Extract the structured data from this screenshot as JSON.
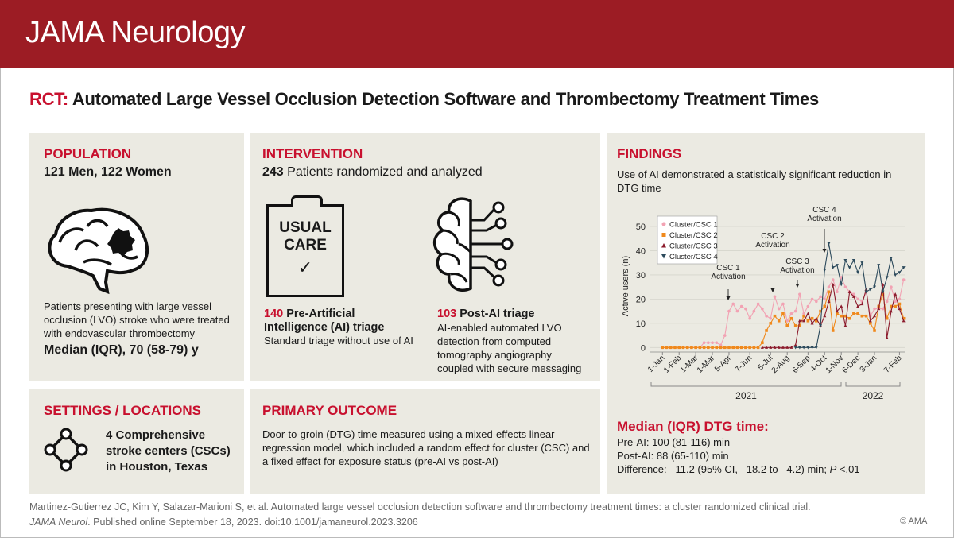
{
  "header": {
    "journal": "JAMA Neurology"
  },
  "title": {
    "prefix": "RCT:",
    "main": "Automated Large Vessel Occlusion Detection Software and Thrombectomy Treatment Times"
  },
  "population": {
    "heading": "POPULATION",
    "subheading": "121 Men, 122 Women",
    "icon": "brain-with-lesion-icon",
    "description": "Patients presenting with large vessel occlusion (LVO) stroke who were treated with endovascular thrombectomy",
    "median": "Median (IQR), 70 (58-79) y"
  },
  "intervention": {
    "heading": "INTERVENTION",
    "subheading_num": "243",
    "subheading": "Patients randomized and analyzed",
    "usual_care": {
      "icon_text_1": "USUAL",
      "icon_text_2": "CARE",
      "icon": "clipboard-check-icon",
      "num": "140",
      "label": "Pre-Artificial Intelligence (AI) triage",
      "desc": "Standard triage without use of AI"
    },
    "ai": {
      "icon": "ai-brain-circuit-icon",
      "num": "103",
      "label": "Post-AI triage",
      "desc": "AI-enabled automated LVO detection from computed tomography angiography coupled with secure messaging"
    }
  },
  "settings": {
    "heading": "SETTINGS / LOCATIONS",
    "icon": "network-nodes-icon",
    "text": "4 Comprehensive stroke centers (CSCs) in Houston, Texas"
  },
  "outcome": {
    "heading": "PRIMARY OUTCOME",
    "text": "Door-to-groin (DTG) time measured using a mixed-effects linear regression model, which included a random effect for cluster (CSC) and a fixed effect for exposure status (pre-AI vs post-AI)"
  },
  "findings": {
    "heading": "FINDINGS",
    "summary": "Use of AI demonstrated a statistically significant reduction in DTG time",
    "median_heading": "Median (IQR) DTG time:",
    "pre": "Pre-AI: 100 (81-116) min",
    "post": "Post-AI: 88 (65-110) min",
    "diff_a": "Difference: –11.2 (95% CI, –18.2 to –4.2) min; ",
    "diff_p": "P",
    "diff_b": " <.01"
  },
  "chart_data": {
    "type": "line",
    "ylabel": "Active users (n)",
    "xlabel": "",
    "ylim": [
      0,
      50
    ],
    "yticks": [
      0,
      10,
      20,
      30,
      40,
      50
    ],
    "grid": "horizontal",
    "legend": "top-left",
    "x_ticks": [
      {
        "label": "1-Jan",
        "index": 0
      },
      {
        "label": "1-Feb",
        "index": 4
      },
      {
        "label": "1-Mar",
        "index": 8
      },
      {
        "label": "1-Mar",
        "index": 12
      },
      {
        "label": "5-Apr",
        "index": 16
      },
      {
        "label": "7-Jun",
        "index": 21
      },
      {
        "label": "5-Jul",
        "index": 26
      },
      {
        "label": "2-Aug",
        "index": 30
      },
      {
        "label": "6-Sep",
        "index": 35
      },
      {
        "label": "4-Oct",
        "index": 39
      },
      {
        "label": "1-Nov",
        "index": 43
      },
      {
        "label": "6-Dec",
        "index": 47
      },
      {
        "label": "3-Jan",
        "index": 51
      },
      {
        "label": "7-Feb",
        "index": 57
      }
    ],
    "years": [
      {
        "label": "2021"
      },
      {
        "label": "2022"
      }
    ],
    "annotations": [
      {
        "line1": "CSC 1",
        "line2": "Activation"
      },
      {
        "line1": "CSC 2",
        "line2": "Activation"
      },
      {
        "line1": "CSC 3",
        "line2": "Activation"
      },
      {
        "line1": "CSC 4",
        "line2": "Activation"
      }
    ],
    "series": [
      {
        "name": "Cluster/CSC 1",
        "color": "#f2a2b3",
        "marker": "circle",
        "values": [
          0,
          0,
          0,
          0,
          0,
          0,
          0,
          0,
          0,
          0,
          2,
          2,
          2,
          2,
          1,
          5,
          15,
          18,
          15,
          17,
          16,
          12,
          15,
          18,
          16,
          13,
          12,
          21,
          16,
          18,
          11,
          14,
          15,
          22,
          14,
          17,
          20,
          19,
          21,
          20,
          25,
          28,
          23,
          29,
          25,
          23,
          22,
          20,
          19,
          23,
          13,
          16,
          16,
          16,
          19,
          25,
          19,
          20,
          28
        ]
      },
      {
        "name": "Cluster/CSC 2",
        "color": "#f0891c",
        "marker": "square",
        "values": [
          0,
          0,
          0,
          0,
          0,
          0,
          0,
          0,
          0,
          0,
          0,
          0,
          0,
          0,
          0,
          0,
          0,
          0,
          0,
          0,
          0,
          0,
          0,
          0,
          2,
          7,
          10,
          13,
          11,
          14,
          9,
          12,
          9,
          9,
          13,
          11,
          12,
          11,
          15,
          17,
          23,
          7,
          14,
          13,
          13,
          12,
          14,
          14,
          13,
          13,
          10,
          7,
          17,
          22,
          12,
          17,
          17,
          18,
          12
        ]
      },
      {
        "name": "Cluster/CSC 3",
        "color": "#8c1b2c",
        "marker": "triangle-up",
        "values": [
          null,
          null,
          null,
          null,
          null,
          null,
          null,
          null,
          null,
          null,
          null,
          null,
          null,
          null,
          null,
          null,
          null,
          null,
          null,
          null,
          null,
          null,
          null,
          null,
          0,
          0,
          0,
          0,
          0,
          0,
          0,
          0,
          1,
          11,
          11,
          14,
          10,
          12,
          9,
          13,
          19,
          26,
          15,
          17,
          9,
          23,
          21,
          17,
          18,
          24,
          11,
          13,
          16,
          26,
          4,
          15,
          22,
          16,
          11
        ]
      },
      {
        "name": "Cluster/CSC 4",
        "color": "#2c4a5c",
        "marker": "triangle-down",
        "values": [
          null,
          null,
          null,
          null,
          null,
          null,
          null,
          null,
          null,
          null,
          null,
          null,
          null,
          null,
          null,
          null,
          null,
          null,
          null,
          null,
          null,
          null,
          null,
          null,
          null,
          null,
          null,
          null,
          null,
          null,
          null,
          null,
          0,
          0,
          0,
          0,
          0,
          0,
          9,
          32,
          43,
          33,
          34,
          26,
          36,
          33,
          36,
          31,
          35,
          23,
          24,
          25,
          34,
          23,
          29,
          37,
          30,
          31,
          33
        ]
      }
    ]
  },
  "citation": {
    "line1": "Martinez-Gutierrez JC, Kim Y, Salazar-Marioni S, et al. Automated large vessel occlusion detection software and thrombectomy treatment times: a cluster randomized clinical trial.",
    "journal_abbr": "JAMA Neurol",
    "line2": ". Published online September 18, 2023. doi:10.1001/jamaneurol.2023.3206",
    "copyright": "© AMA"
  }
}
